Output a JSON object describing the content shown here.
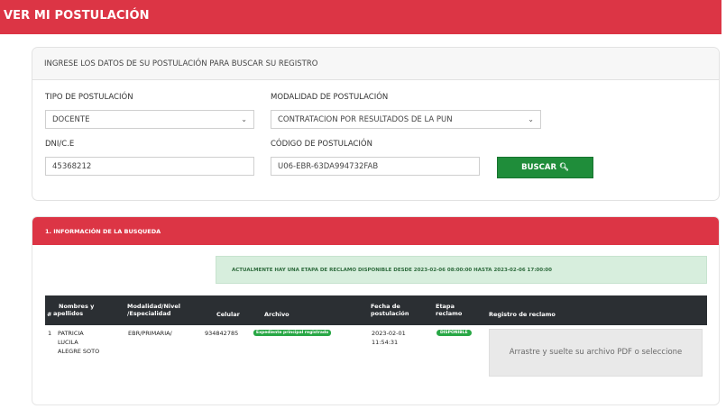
{
  "page": {
    "title": "VER MI POSTULACIÓN"
  },
  "search": {
    "header": "INGRESE LOS DATOS DE SU POSTULACIÓN PARA BUSCAR SU REGISTRO",
    "tipo_label": "TIPO DE POSTULACIÓN",
    "tipo_value": "DOCENTE",
    "modalidad_label": "MODALIDAD DE POSTULACIÓN",
    "modalidad_value": "CONTRATACION POR RESULTADOS DE LA PUN",
    "dni_label": "DNI/C.E",
    "dni_value": "45368212",
    "codigo_label": "CÓDIGO DE POSTULACIÓN",
    "codigo_value": "U06-EBR-63DA994732FAB",
    "button_label": "BUSCAR",
    "button_icon": "🔍︎"
  },
  "info": {
    "header": "1. INFORMACIÓN DE LA BUSQUEDA",
    "alert": "ACTUALMENTE HAY UNA ETAPA DE RECLAMO DISPONIBLE DESDE 2023-02-06 08:00:00 HASTA 2023-02-06 17:00:00",
    "columns": {
      "num": "#",
      "nombres_1": "Nombres y",
      "nombres_2": "apellidos",
      "modalidad_1": "Modalidad/Nivel",
      "modalidad_2": "/Especialidad",
      "celular": "Celular",
      "archivo": "Archivo",
      "fecha_1": "Fecha de",
      "fecha_2": "postulación",
      "etapa_1": "Etapa",
      "etapa_2": "reclamo",
      "registro": "Registro de reclamo"
    },
    "rows": [
      {
        "num": "1",
        "nombre_1": "PATRICIA",
        "nombre_2": "LUCILA",
        "nombre_3": "ALEGRE SOTO",
        "modalidad": "EBR/PRIMARIA/",
        "celular": "934842785",
        "archivo_badge": "Expediente principal registrado",
        "fecha_1": "2023-02-01",
        "fecha_2": "11:54:31",
        "etapa_badge": "DISPONIBLE",
        "dropzone": "Arrastre y suelte su archivo PDF o seleccione"
      }
    ]
  },
  "colors": {
    "brand_red": "#dc3545",
    "button_green": "#1f8d3a",
    "alert_bg": "#d7eedd",
    "table_header": "#2b2f33"
  }
}
